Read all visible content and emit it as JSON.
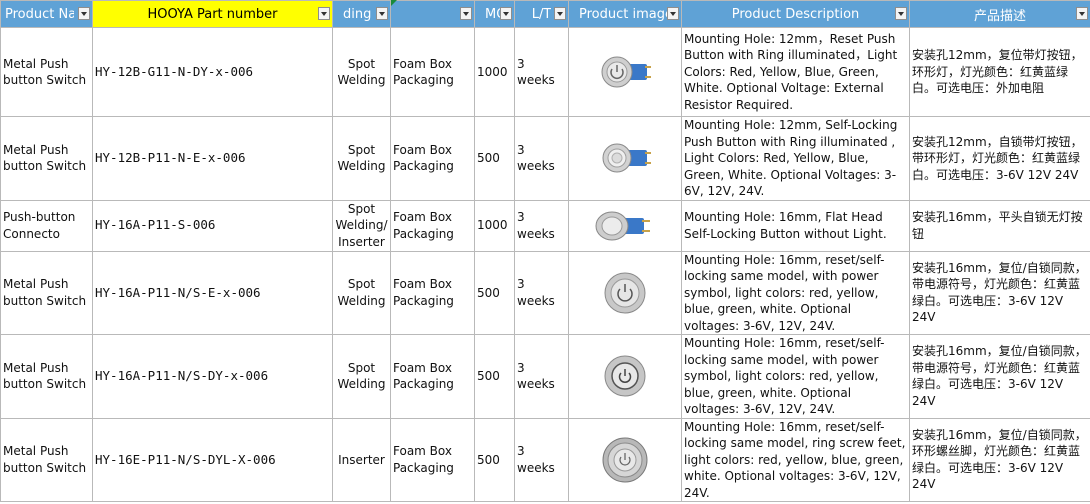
{
  "headers": [
    "Product Nar",
    "HOOYA Part number",
    "ding Pro",
    "",
    "MO",
    "L/T",
    "Product image",
    "Product Description",
    "产品描述"
  ],
  "rows": [
    {
      "name": "Metal Push button Switch",
      "part": "HY-12B-G11-N-DY-x-006",
      "process": "Spot Welding",
      "packaging": "Foam Box Packaging",
      "moq": "1000",
      "lt": "3 weeks",
      "icon": "ring-power-button-icon",
      "desc": "Mounting Hole: 12mm，Reset Push Button with Ring illuminated，Light Colors: Red, Yellow, Blue, Green, White. Optional Voltage: External Resistor Required.",
      "desc_cn": "安装孔12mm，复位带灯按钮，环形灯，灯光颜色：红黄蓝绿白。可选电压：外加电阻"
    },
    {
      "name": "Metal Push button Switch",
      "part": "HY-12B-P11-N-E-x-006",
      "process": "Spot Welding",
      "packaging": "Foam Box Packaging",
      "moq": "500",
      "lt": "3 weeks",
      "icon": "self-locking-button-icon",
      "desc": "Mounting Hole: 12mm, Self-Locking Push Button with Ring illuminated , Light Colors: Red, Yellow, Blue, Green, White. Optional Voltages: 3-6V, 12V, 24V.",
      "desc_cn": "安装孔12mm，自锁带灯按钮，带环形灯，灯光颜色：红黄蓝绿白。可选电压：3-6V 12V 24V"
    },
    {
      "name": "Push-button Connecto",
      "part": "HY-16A-P11-S-006",
      "process": "Spot Welding/ Inserter",
      "packaging": "Foam Box Packaging",
      "moq": "1000",
      "lt": "3 weeks",
      "icon": "flat-head-button-icon",
      "desc": "Mounting Hole: 16mm, Flat Head Self-Locking Button without Light.",
      "desc_cn": "安装孔16mm，平头自锁无灯按钮"
    },
    {
      "name": "Metal Push button Switch",
      "part": "HY-16A-P11-N/S-E-x-006",
      "process": "Spot Welding",
      "packaging": "Foam Box Packaging",
      "moq": "500",
      "lt": "3 weeks",
      "icon": "power-symbol-button-icon",
      "desc": "Mounting Hole: 16mm, reset/self-locking same model, with power symbol, light colors: red, yellow, blue, green, white. Optional voltages: 3-6V, 12V, 24V.",
      "desc_cn": "安装孔16mm，复位/自锁同款，带电源符号，灯光颜色：红黄蓝绿白。可选电压：3-6V 12V 24V"
    },
    {
      "name": "Metal Push button Switch",
      "part": "HY-16A-P11-N/S-DY-x-006",
      "process": "Spot Welding",
      "packaging": "Foam Box Packaging",
      "moq": "500",
      "lt": "3 weeks",
      "icon": "power-ring-button-icon",
      "desc": "Mounting Hole: 16mm, reset/self-locking same model, with power symbol, light colors: red, yellow, blue, green, white. Optional voltages: 3-6V, 12V, 24V.",
      "desc_cn": "安装孔16mm，复位/自锁同款，带电源符号，灯光颜色：红黄蓝绿白。可选电压：3-6V 12V 24V"
    },
    {
      "name": "Metal Push button Switch",
      "part": "HY-16E-P11-N/S-DYL-X-006",
      "process": "Inserter",
      "packaging": "Foam Box Packaging",
      "moq": "500",
      "lt": "3 weeks",
      "icon": "screw-feet-button-icon",
      "desc": "Mounting Hole: 16mm, reset/self-locking same model, ring screw feet, light colors: red, yellow, blue, green, white. Optional voltages: 3-6V, 12V, 24V.",
      "desc_cn": "安装孔16mm，复位/自锁同款，环形螺丝脚，灯光颜色：红黄蓝绿白。可选电压：3-6V 12V 24V"
    }
  ]
}
